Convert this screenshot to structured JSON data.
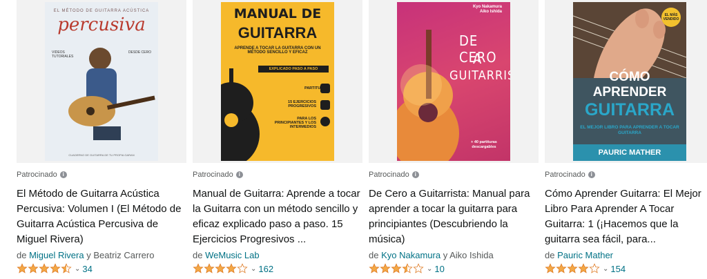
{
  "results": [
    {
      "cover": {
        "series_line": "EL MÉTODO DE GUITARRA ACÚSTICA",
        "title": "percusiva",
        "left_text": "VIDEOS TUTORIALES",
        "right_text": "DESDE CERO",
        "footer": "CUADERNO DE GUITARRA DE TU PROPIA GARAN"
      },
      "sponsored_label": "Patrocinado",
      "title": "El Método de Guitarra Acústica Percusiva: Volumen I (El Método de Guitarra Acústica Percusiva de Miguel Rivera)",
      "author_prefix": "de",
      "author_primary": "Miguel Rivera",
      "author_joiner": "y",
      "author_secondary": "Beatriz Carrero",
      "rating": 4.5,
      "review_count": "34"
    },
    {
      "cover": {
        "title_line1": "MANUAL DE",
        "title_line2": "GUITARRA",
        "subtitle": "APRENDE A TOCAR LA GUITARRA CON UN MÉTODO SENCILLO Y EFICAZ",
        "pill": "EXPLICADO PASO A PASO",
        "item1": "PARTITURAS",
        "item2": "15 EJERCICIOS PROGRESIVOS",
        "item3": "PARA LOS PRINCIPIANTES Y LOS INTERMEDIOS"
      },
      "sponsored_label": "Patrocinado",
      "title": "Manual de Guitarra: Aprende a tocar la Guitarra con un método sencillo y eficaz explicado paso a paso. 15 Ejercicios Progresivos ...",
      "author_prefix": "de",
      "author_primary": "WeMusic Lab",
      "author_joiner": "",
      "author_secondary": "",
      "rating": 4.0,
      "review_count": "162"
    },
    {
      "cover": {
        "author1": "Kyo Nakamura",
        "author2": "Aiko Ishida",
        "t1": "DE CERO",
        "t2": "A",
        "t3": "GUITARRISTA",
        "note": "+ 40 partituras descargables"
      },
      "sponsored_label": "Patrocinado",
      "title": "De Cero a Guitarrista: Manual para aprender a tocar la guitarra para principiantes (Descubriendo la música)",
      "author_prefix": "de",
      "author_primary": "Kyo Nakamura",
      "author_joiner": "y",
      "author_secondary": "Aiko Ishida",
      "rating": 3.5,
      "review_count": "10"
    },
    {
      "cover": {
        "badge": "EL MÁS VENDIDO",
        "t1": "CÓMO",
        "t2": "APRENDER",
        "t3": "GUITARRA",
        "t4": "EL MEJOR LIBRO PARA APRENDER A TOCAR GUITARRA",
        "author": "PAURIC MATHER"
      },
      "sponsored_label": "Patrocinado",
      "title": "Cómo Aprender Guitarra: El Mejor Libro Para Aprender A Tocar Guitarra: 1 (¡Hacemos que la guitarra sea fácil, para...",
      "author_prefix": "de",
      "author_primary": "Pauric Mather",
      "author_joiner": "",
      "author_secondary": "",
      "rating": 4.0,
      "review_count": "154"
    }
  ],
  "colors": {
    "star": "#f3a847",
    "link": "#007185",
    "muted": "#565959",
    "image_bg": "#f2f2f2"
  },
  "icons": {
    "info": "info-icon",
    "star": "star-icon",
    "chevron": "chevron-down-icon"
  }
}
